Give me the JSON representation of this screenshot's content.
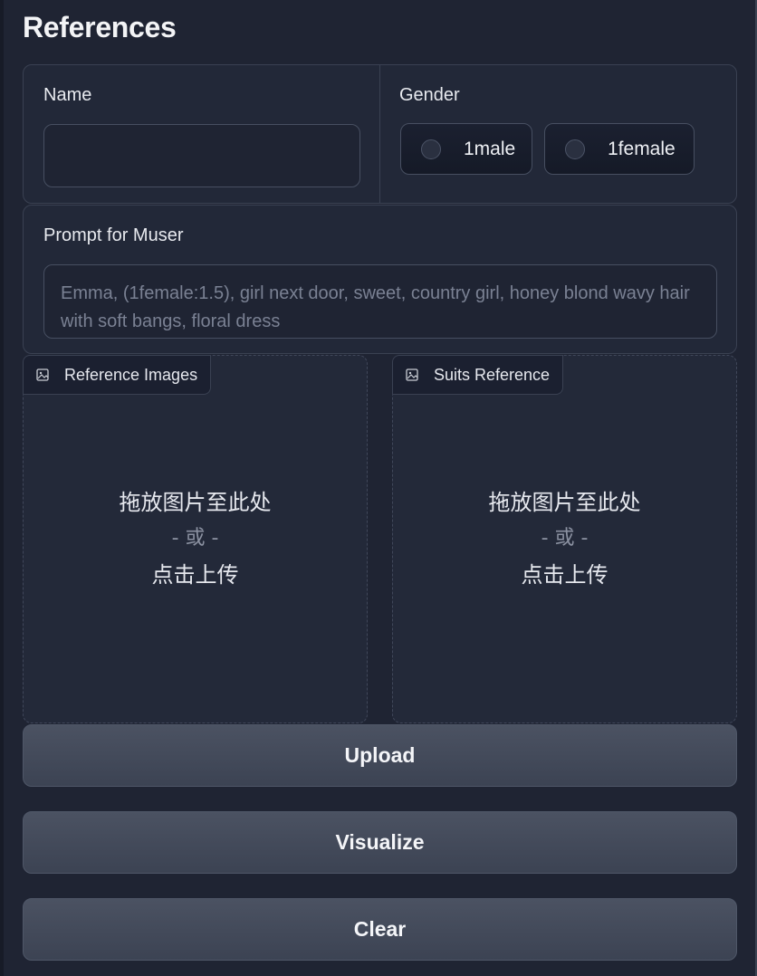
{
  "section": {
    "title": "References"
  },
  "name_field": {
    "label": "Name",
    "value": "",
    "placeholder": ""
  },
  "gender": {
    "label": "Gender",
    "options": [
      {
        "label": "1male",
        "selected": false
      },
      {
        "label": "1female",
        "selected": false
      }
    ]
  },
  "prompt": {
    "label": "Prompt for Muser",
    "placeholder": "Emma, (1female:1.5), girl next door, sweet, country girl, honey blond wavy hair with soft bangs, floral dress"
  },
  "dropzones": [
    {
      "label": "Reference Images",
      "icon": "image-icon",
      "drop_text": "拖放图片至此处",
      "or_text": "- 或 -",
      "click_text": "点击上传"
    },
    {
      "label": "Suits Reference",
      "icon": "image-icon",
      "drop_text": "拖放图片至此处",
      "or_text": "- 或 -",
      "click_text": "点击上传"
    }
  ],
  "actions": {
    "upload": "Upload",
    "visualize": "Visualize",
    "clear": "Clear"
  },
  "colors": {
    "background": "#1f2433",
    "panel_border": "#3a4152",
    "button": "#454c5c"
  }
}
